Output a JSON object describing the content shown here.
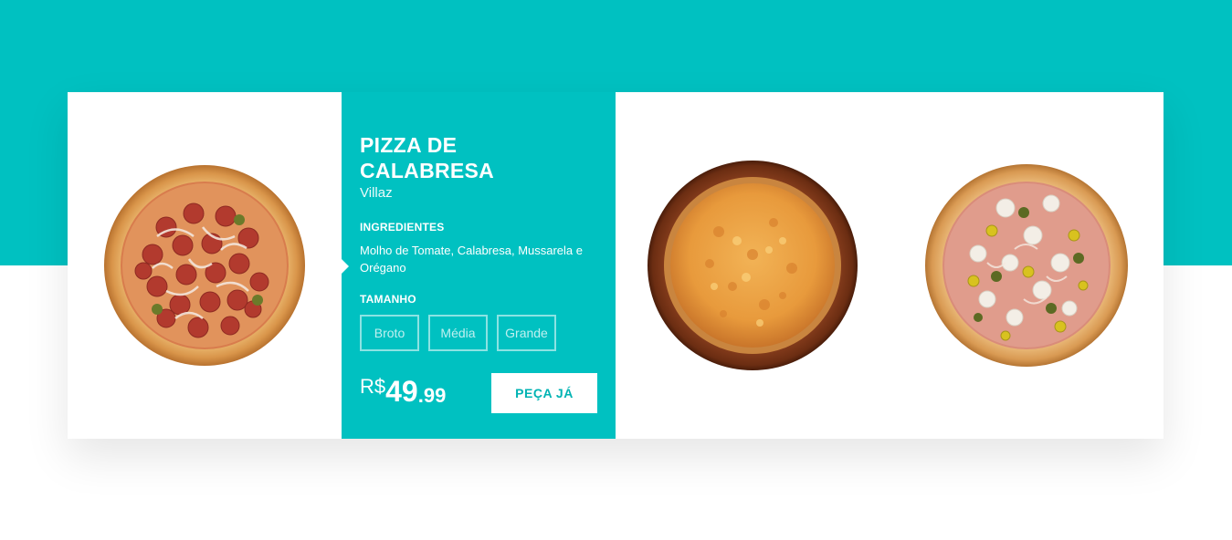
{
  "product": {
    "title": "PIZZA DE CALABRESA",
    "brand": "Villaz",
    "ingredients_label": "INGREDIENTES",
    "ingredients": "Molho de Tomate, Calabresa, Mussarela e Orégano",
    "size_label": "TAMANHO",
    "sizes": [
      "Broto",
      "Média",
      "Grande"
    ],
    "price": {
      "currency": "R$",
      "integer": "49",
      "decimal": ".99"
    },
    "order_button": "PEÇA JÁ"
  },
  "theme": {
    "accent": "#00c1c1",
    "card_background": "#ffffff"
  },
  "gallery": [
    {
      "name": "pizza-calabresa-image"
    },
    {
      "name": "pizza-mussarela-image"
    },
    {
      "name": "pizza-portuguesa-image"
    }
  ]
}
